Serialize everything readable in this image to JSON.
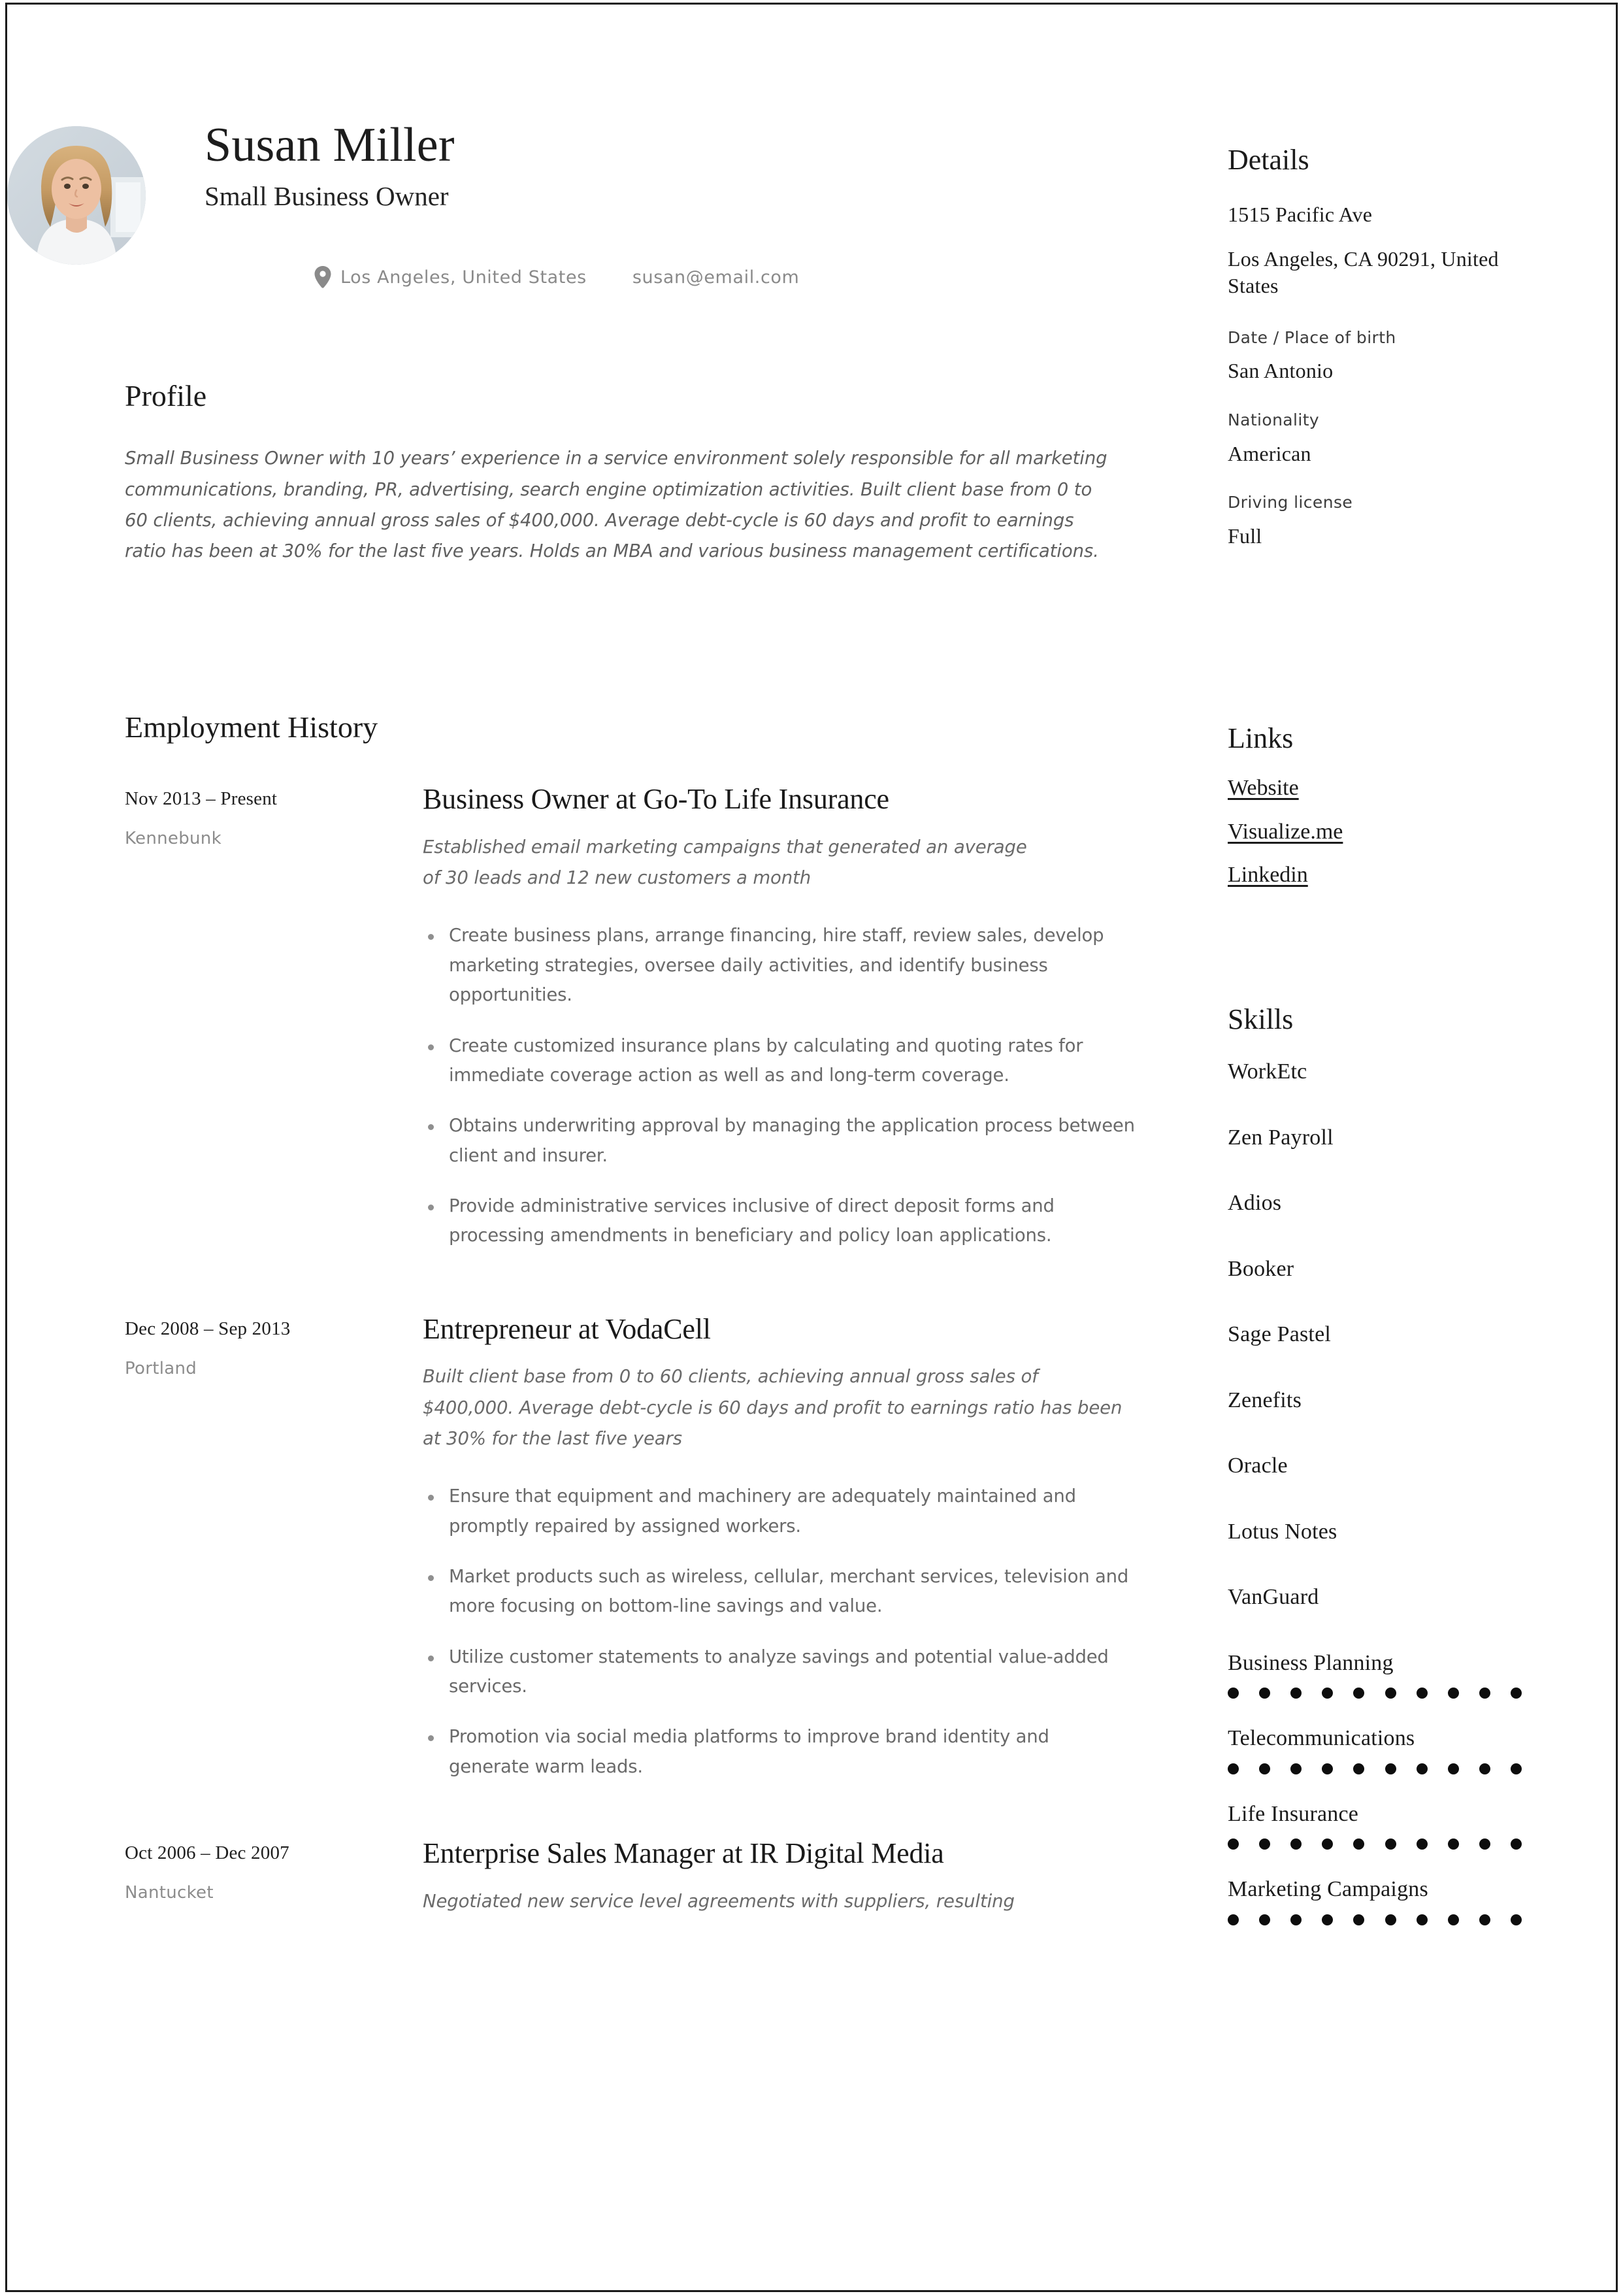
{
  "document": {
    "type": "resume",
    "page_border_color": "#1a1a1a",
    "background_color": "#ffffff"
  },
  "header": {
    "name": "Susan Miller",
    "job_title": "Small Business Owner",
    "location": "Los Angeles, United States",
    "email": "susan@email.com",
    "location_icon": "map-pin-icon",
    "avatar": "profile-photo"
  },
  "profile": {
    "heading": "Profile",
    "text": "Small Business Owner with 10 years’ experience in a service environment solely responsible for all marketing communications, branding, PR, advertising, search engine optimization activities. Built client base from 0 to 60 clients, achieving annual gross sales of $400,000. Average debt-cycle is 60 days and profit to earnings ratio has been at 30% for the last five years. Holds an MBA and various business management certifications."
  },
  "employment": {
    "heading": "Employment History",
    "jobs": [
      {
        "dates": "Nov 2013 – Present",
        "city": "Kennebunk",
        "title": "Business Owner at Go-To Life Insurance",
        "summary": "Established email marketing campaigns that generated an average of 30 leads and 12 new customers a month",
        "bullets": [
          "Create business plans, arrange financing, hire staff, review sales, develop marketing strategies, oversee daily activities, and identify business opportunities.",
          "Create customized insurance plans by calculating and quoting rates for immediate coverage action as well as and long-term coverage.",
          "Obtains underwriting approval by managing the application process between client and insurer.",
          "Provide administrative services inclusive of direct deposit forms and processing amendments in beneficiary and policy loan applications."
        ]
      },
      {
        "dates": "Dec 2008 – Sep 2013",
        "city": "Portland",
        "title": "Entrepreneur at VodaCell",
        "summary": "Built client base from 0 to 60 clients, achieving annual gross sales of $400,000. Average debt-cycle is 60 days and profit to earnings ratio has been at 30% for the last five years",
        "bullets": [
          "Ensure that equipment and machinery are adequately maintained and promptly repaired by assigned workers.",
          "Market products such as wireless, cellular, merchant services, television and more focusing on bottom-line savings and value.",
          "Utilize customer statements to analyze savings and potential value-added services.",
          "Promotion via social media platforms to improve brand identity and generate warm leads."
        ]
      },
      {
        "dates": "Oct 2006 – Dec 2007",
        "city": "Nantucket",
        "title": "Enterprise Sales Manager at IR Digital Media",
        "summary": "Negotiated new service level agreements with suppliers, resulting",
        "bullets": []
      }
    ]
  },
  "details": {
    "heading": "Details",
    "address_line1": "1515 Pacific Ave",
    "address_line2": "Los Angeles, CA 90291, United States",
    "birth_label": "Date / Place of birth",
    "birth_value": "San Antonio",
    "nationality_label": "Nationality",
    "nationality_value": "American",
    "license_label": "Driving license",
    "license_value": "Full"
  },
  "links": {
    "heading": "Links",
    "items": [
      {
        "label": "Website"
      },
      {
        "label": "Visualize.me"
      },
      {
        "label": "Linkedin"
      }
    ]
  },
  "skills": {
    "heading": "Skills",
    "items": [
      {
        "label": "WorkEtc",
        "rating": null,
        "max": 10
      },
      {
        "label": "Zen Payroll",
        "rating": null,
        "max": 10
      },
      {
        "label": "Adios",
        "rating": null,
        "max": 10
      },
      {
        "label": "Booker",
        "rating": null,
        "max": 10
      },
      {
        "label": "Sage Pastel",
        "rating": null,
        "max": 10
      },
      {
        "label": "Zenefits",
        "rating": null,
        "max": 10
      },
      {
        "label": "Oracle",
        "rating": null,
        "max": 10
      },
      {
        "label": "Lotus Notes",
        "rating": null,
        "max": 10
      },
      {
        "label": "VanGuard",
        "rating": null,
        "max": 10
      },
      {
        "label": "Business Planning",
        "rating": 10,
        "max": 10
      },
      {
        "label": "Telecommunications",
        "rating": 10,
        "max": 10
      },
      {
        "label": "Life Insurance",
        "rating": 10,
        "max": 10
      },
      {
        "label": "Marketing Campaigns",
        "rating": 10,
        "max": 10
      }
    ]
  }
}
